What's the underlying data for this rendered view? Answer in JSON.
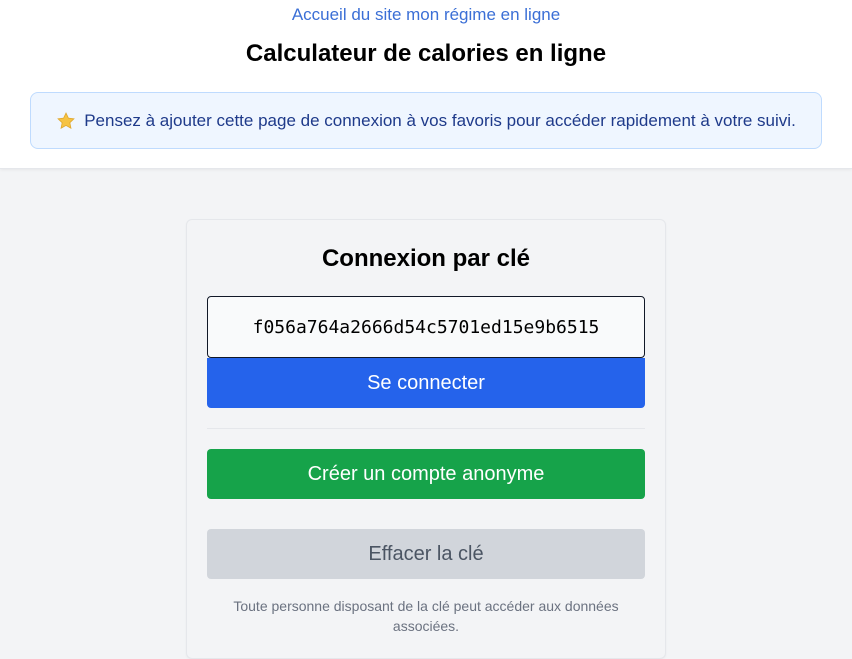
{
  "header": {
    "home_link": "Accueil du site mon régime en ligne",
    "title": "Calculateur de calories en ligne",
    "notice": {
      "icon": "star-icon",
      "text": "Pensez à ajouter cette page de connexion à vos favoris pour accéder rapidement à votre suivi."
    }
  },
  "login_card": {
    "title": "Connexion par clé",
    "key_input_value": "f056a764a2666d54c5701ed15e9b6515",
    "login_button": "Se connecter",
    "create_account_button": "Créer un compte anonyme",
    "clear_key_button": "Effacer la clé",
    "disclaimer": "Toute personne disposant de la clé peut accéder aux données associées."
  },
  "colors": {
    "link": "#3b6fd6",
    "primary": "#2563eb",
    "success": "#16a34a",
    "neutral": "#d1d5db",
    "notice_bg": "#eff6ff",
    "notice_text": "#1e3a8a"
  }
}
